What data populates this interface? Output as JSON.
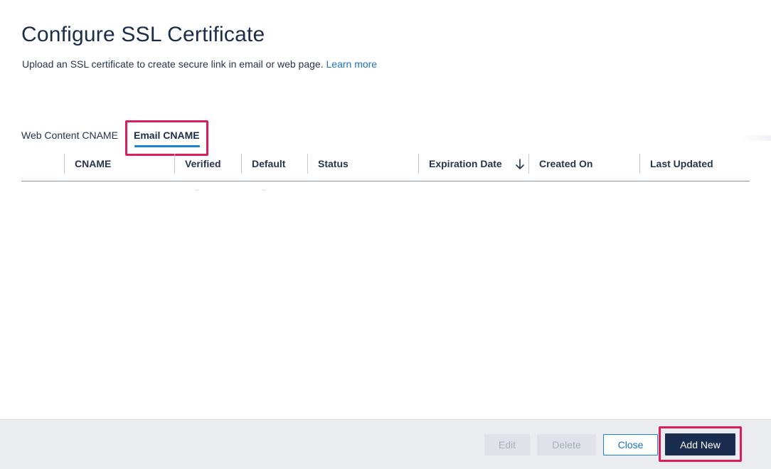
{
  "dialog": {
    "title": "Configure SSL Certificate",
    "subtitle": "Upload an SSL certificate to create secure link in email or web page.",
    "learn_more": "Learn more"
  },
  "tabs": [
    {
      "label": "Web Content CNAME",
      "active": false
    },
    {
      "label": "Email CNAME",
      "active": true
    }
  ],
  "table": {
    "columns": [
      {
        "label": ""
      },
      {
        "label": "CNAME"
      },
      {
        "label": "Verified"
      },
      {
        "label": "Default"
      },
      {
        "label": "Status"
      },
      {
        "label": "Expiration Date",
        "sorted": "descending"
      },
      {
        "label": "Created On"
      },
      {
        "label": "Last Updated"
      }
    ],
    "rows": []
  },
  "footer": {
    "edit_label": "Edit",
    "delete_label": "Delete",
    "close_label": "Close",
    "add_new_label": "Add New"
  },
  "colors": {
    "accent": "#1a82d2",
    "primary_button": "#1b2d4f",
    "highlight": "#d91e5b",
    "title_text": "#1c2d4a"
  },
  "icons": {
    "sort": "arrow-down-icon"
  }
}
